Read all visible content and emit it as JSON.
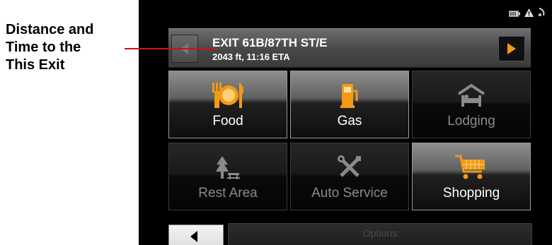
{
  "callout": {
    "lines": [
      "Distance and",
      "Time to the",
      "This Exit"
    ],
    "pointer_color": "#d0101a"
  },
  "status": {
    "icons": [
      "battery-icon",
      "warning-icon",
      "satellite-icon"
    ]
  },
  "exit": {
    "name": "EXIT 61B/87TH ST/E",
    "meta": "2043 ft, 11:16 ETA",
    "next_arrow_color": "#f29a14"
  },
  "categories": [
    {
      "label": "Food",
      "icon": "food-icon",
      "enabled": true
    },
    {
      "label": "Gas",
      "icon": "gas-pump-icon",
      "enabled": true
    },
    {
      "label": "Lodging",
      "icon": "lodging-icon",
      "enabled": false
    },
    {
      "label": "Rest Area",
      "icon": "rest-area-icon",
      "enabled": false
    },
    {
      "label": "Auto Service",
      "icon": "auto-service-icon",
      "enabled": false
    },
    {
      "label": "Shopping",
      "icon": "shopping-cart-icon",
      "enabled": true
    }
  ],
  "footer": {
    "options_label": "Options"
  },
  "colors": {
    "accent": "#f29a14",
    "background": "#000000"
  }
}
